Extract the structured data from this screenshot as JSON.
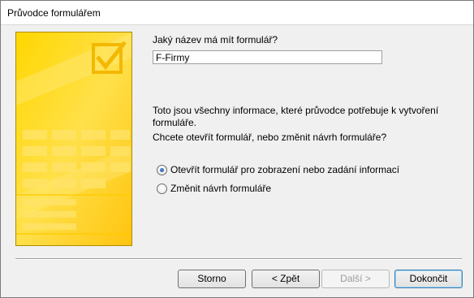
{
  "window": {
    "title": "Průvodce formulářem"
  },
  "main": {
    "question": "Jaký název má mít formulář?",
    "form_name_value": "F-Firmy",
    "info_text": "Toto jsou všechny informace, které průvodce potřebuje k vytvoření formuláře.",
    "choice_question": "Chcete otevřít formulář, nebo změnit návrh formuláře?",
    "options": [
      {
        "label": "Otevřít formulář pro zobrazení nebo zadání informací",
        "selected": true
      },
      {
        "label": "Změnit návrh formuláře",
        "selected": false
      }
    ]
  },
  "buttons": {
    "cancel": "Storno",
    "back": "< Zpět",
    "next": "Další >",
    "finish": "Dokončit"
  },
  "colors": {
    "wizard_panel_yellow": "#ffd21f",
    "wizard_panel_light": "#ffe566",
    "default_button_border": "#3c7fb1"
  }
}
